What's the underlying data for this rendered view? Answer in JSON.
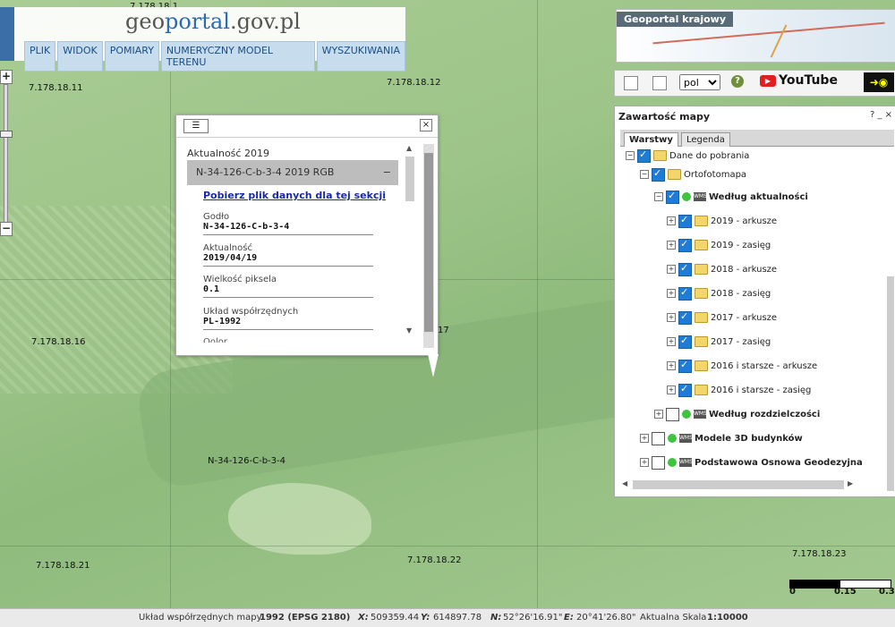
{
  "logo": {
    "text_pre": "geo",
    "text_brand": "portal",
    "text_post": ".gov.pl"
  },
  "menu": [
    "PLIK",
    "WIDOK",
    "POMIARY",
    "NUMERYCZNY MODEL TERENU",
    "WYSZUKIWANIA"
  ],
  "zoom": {
    "plus": "+",
    "minus": "−"
  },
  "map_labels": {
    "l1": "7.178.18.11",
    "l2": "7.178.18.12",
    "l3": "7.178.18.16",
    "l4": "17",
    "l5": "7.178.18.21",
    "l6": "7.178.18.22",
    "l7": "7.178.18.23",
    "l8": "N-34-126-C-b-3-4",
    "l9": "7.178.18.1"
  },
  "popup": {
    "title": "Aktualność 2019",
    "section": "N-34-126-C-b-3-4 2019 RGB",
    "section_toggle": "−",
    "download": "Pobierz plik danych dla tej sekcji",
    "fields": [
      {
        "label": "Godło",
        "value": "N-34-126-C-b-3-4"
      },
      {
        "label": "Aktualność",
        "value": "2019/04/19"
      },
      {
        "label": "Wielkość piksela",
        "value": "0.1"
      },
      {
        "label": "Układ współrzędnych",
        "value": "PL-1992"
      }
    ],
    "cut_text": "Oolor ..."
  },
  "national_panel": {
    "title": "Geoportal krajowy"
  },
  "toolbar": {
    "lang": "pol",
    "lang_options": [
      "pol"
    ],
    "youtube": "YouTube",
    "help": "?"
  },
  "layers_panel": {
    "title": "Zawartość mapy",
    "buttons": "?  _  ×",
    "tabs": [
      "Warstwy",
      "Legenda"
    ],
    "tree": [
      {
        "label": "Dane do pobrania"
      },
      {
        "label": "Ortofotomapa"
      },
      {
        "label": "Według aktualności"
      },
      {
        "label": "2019 - arkusze"
      },
      {
        "label": "2019 - zasięg"
      },
      {
        "label": "2018 - arkusze"
      },
      {
        "label": "2018 - zasięg"
      },
      {
        "label": "2017 - arkusze"
      },
      {
        "label": "2017 - zasięg"
      },
      {
        "label": "2016 i starsze - arkusze"
      },
      {
        "label": "2016 i starsze - zasięg"
      },
      {
        "label": "Według rozdzielczości"
      },
      {
        "label": "Modele 3D budynków"
      },
      {
        "label": "Podstawowa Osnowa Geodezyjna"
      }
    ]
  },
  "scale": {
    "s0": "0",
    "s1": "0.15",
    "s2": "0.3"
  },
  "status": {
    "crs_label": "Układ współrzędnych mapy",
    "crs_value": "1992 (EPSG 2180)",
    "x_label": "X:",
    "x_value": "509359.44",
    "y_label": "Y:",
    "y_value": "614897.78",
    "n_label": "N:",
    "n_value": "52°26'16.91\"",
    "e_label": "E:",
    "e_value": "20°41'26.80\"",
    "scale_label": "Aktualna Skala",
    "scale_value": "1:10000"
  }
}
